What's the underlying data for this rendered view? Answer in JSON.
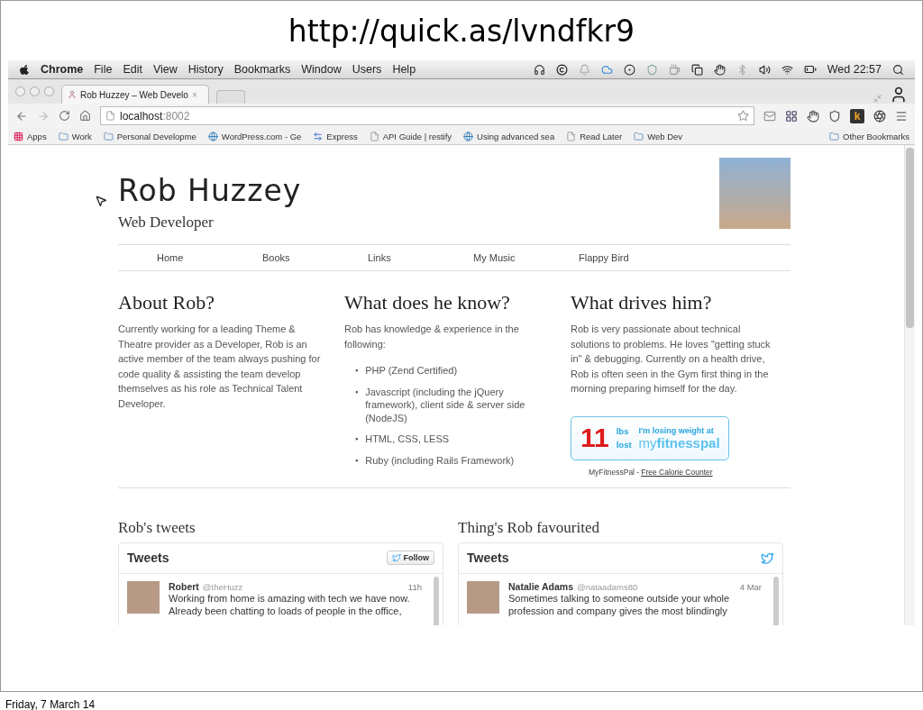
{
  "slide": {
    "title": "http://quick.as/lvndfkr9",
    "footer": "Friday, 7 March 14"
  },
  "menu_bar": {
    "app": "Chrome",
    "items": [
      "File",
      "Edit",
      "View",
      "History",
      "Bookmarks",
      "Window",
      "Users",
      "Help"
    ],
    "clock": "Wed 22:57"
  },
  "browser": {
    "tab": {
      "title": "Rob Huzzey – Web Develo",
      "close": "×",
      "selected": true
    },
    "url_host": "localhost",
    "url_port": ":8002",
    "extension_letter": "k",
    "bookmarks": [
      {
        "label": "Apps",
        "kind": "apps"
      },
      {
        "label": "Work",
        "kind": "folder"
      },
      {
        "label": "Personal Developme",
        "kind": "folder"
      },
      {
        "label": "WordPress.com - Ge",
        "kind": "site"
      },
      {
        "label": "Express",
        "kind": "arrows"
      },
      {
        "label": "API Guide | restify",
        "kind": "page"
      },
      {
        "label": "Using advanced sea",
        "kind": "site"
      },
      {
        "label": "Read Later",
        "kind": "page"
      },
      {
        "label": "Web Dev",
        "kind": "folder"
      }
    ],
    "other_bookmarks": "Other Bookmarks"
  },
  "page": {
    "name": "Rob Huzzey",
    "role": "Web Developer",
    "nav": [
      {
        "label": "Home"
      },
      {
        "label": "Books"
      },
      {
        "label": "Links"
      },
      {
        "label": "My Music"
      },
      {
        "label": "Flappy Bird"
      }
    ],
    "list_marker": "▪",
    "columns": [
      {
        "heading": "About Rob?",
        "paragraphs": [
          "Currently working for a leading Theme & Theatre provider as a Developer, Rob is an active member of the team always pushing for code quality & assisting the team develop themselves as his role as Technical Talent Developer."
        ]
      },
      {
        "heading": "What does he know?",
        "paragraphs": [
          "Rob has knowledge & experience in the following:"
        ],
        "list": [
          "PHP (Zend Certified)",
          "Javascript (including the jQuery framework), client side & server side (NodeJS)",
          "HTML, CSS, LESS",
          "Ruby (including Rails Framework)"
        ]
      },
      {
        "heading": "What drives him?",
        "paragraphs": [
          "Rob is very passionate about technical solutions to problems. He loves \"getting stuck in\" & debugging. Currently on a health drive, Rob is often seen in the Gym first thing in the morning preparing himself for the day."
        ]
      }
    ],
    "fitness_widget": {
      "number": "11",
      "unit_1": "lbs",
      "unit_2": "lost",
      "tagline": "I'm losing weight at",
      "brand_1": "my",
      "brand_2": "fitnesspal",
      "caption": "MyFitnessPal - ",
      "caption_link": "Free Calorie Counter"
    },
    "feeds": [
      {
        "heading": "Rob's tweets",
        "card_title": "Tweets",
        "follow_button": "Follow",
        "tweet": {
          "name": "Robert",
          "handle": "@theHuzz",
          "time": "11h",
          "lines": [
            "Working from home is amazing with tech we have now.",
            "Already been chatting to loads of people in the office,"
          ]
        }
      },
      {
        "heading": "Thing's Rob favourited",
        "card_title": "Tweets",
        "tweet": {
          "name": "Natalie Adams",
          "handle": "@nataadams80",
          "time": "4 Mar",
          "lines": [
            "Sometimes talking to someone outside your whole",
            "profession and company gives the most blindingly"
          ]
        }
      }
    ]
  }
}
